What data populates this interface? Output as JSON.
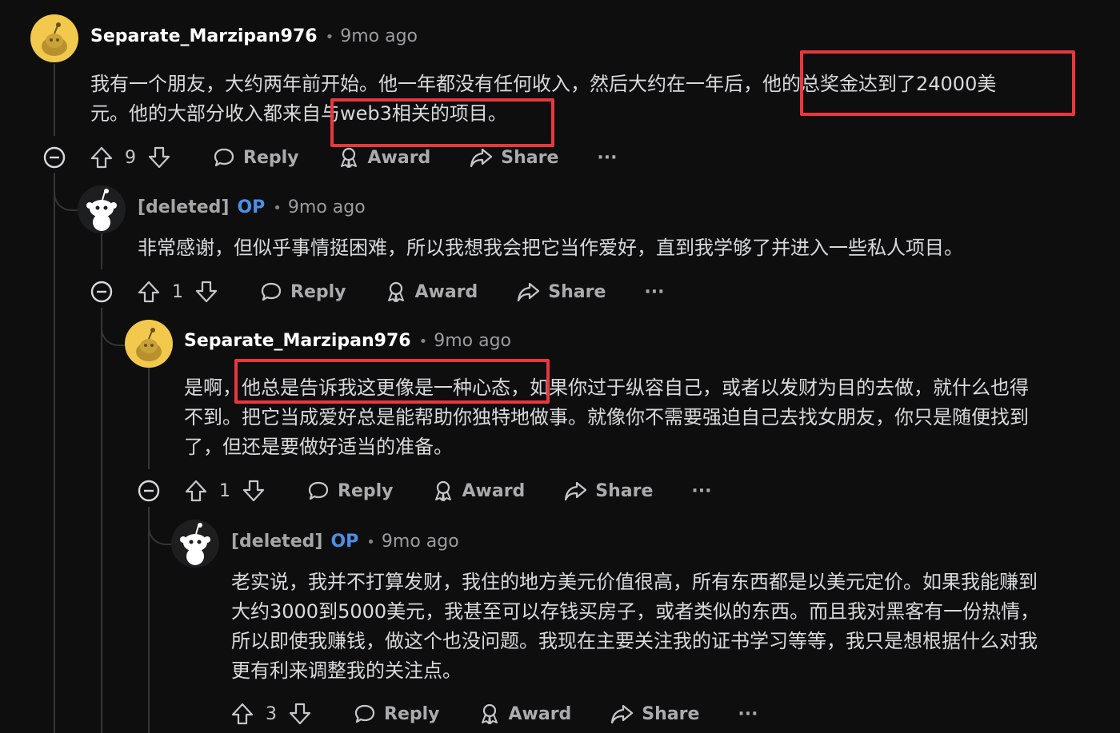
{
  "comments": [
    {
      "username": "Separate_Marzipan976",
      "op_badge": "",
      "time": "9mo ago",
      "text_lines": [
        "我有一个朋友，大约两年前开始。他一年都没有任何收入，然后大约在一年后，他的总奖金达到了24000美",
        "元。他的大部分收入都来自与web3相关的项目。"
      ],
      "votes": "9",
      "reply_label": "Reply",
      "award_label": "Award",
      "share_label": "Share",
      "more_label": "···"
    },
    {
      "username": "[deleted]",
      "op_badge": "OP",
      "time": "9mo ago",
      "text_lines": [
        "非常感谢，但似乎事情挺困难，所以我想我会把它当作爱好，直到我学够了并进入一些私人项目。"
      ],
      "votes": "1",
      "reply_label": "Reply",
      "award_label": "Award",
      "share_label": "Share",
      "more_label": "···"
    },
    {
      "username": "Separate_Marzipan976",
      "op_badge": "",
      "time": "9mo ago",
      "text_lines": [
        "是啊，他总是告诉我这更像是一种心态，如果你过于纵容自己，或者以发财为目的去做，就什么也得",
        "不到。把它当成爱好总是能帮助你独特地做事。就像你不需要强迫自己去找女朋友，你只是随便找到",
        "了，但还是要做好适当的准备。"
      ],
      "votes": "1",
      "reply_label": "Reply",
      "award_label": "Award",
      "share_label": "Share",
      "more_label": "···"
    },
    {
      "username": "[deleted]",
      "op_badge": "OP",
      "time": "9mo ago",
      "text_lines": [
        "老实说，我并不打算发财，我住的地方美元价值很高，所有东西都是以美元定价。如果我能赚到",
        "大约3000到5000美元，我甚至可以存钱买房子，或者类似的东西。而且我对黑客有一份热情，",
        "所以即使我赚钱，做这个也没问题。我现在主要关注我的证书学习等等，我只是想根据什么对我",
        "更有利来调整我的关注点。"
      ],
      "votes": "3",
      "reply_label": "Reply",
      "award_label": "Award",
      "share_label": "Share",
      "more_label": "···"
    }
  ],
  "colors": {
    "background": "#0e0e0f",
    "highlight_box": "#e8383f",
    "op_badge": "#4c8fe6",
    "avatar_yellow": "#f2c94c"
  },
  "icons": [
    "collapse-icon",
    "upvote-icon",
    "downvote-icon",
    "reply-icon",
    "award-icon",
    "share-icon",
    "more-icon",
    "snoo-avatar-icon"
  ]
}
